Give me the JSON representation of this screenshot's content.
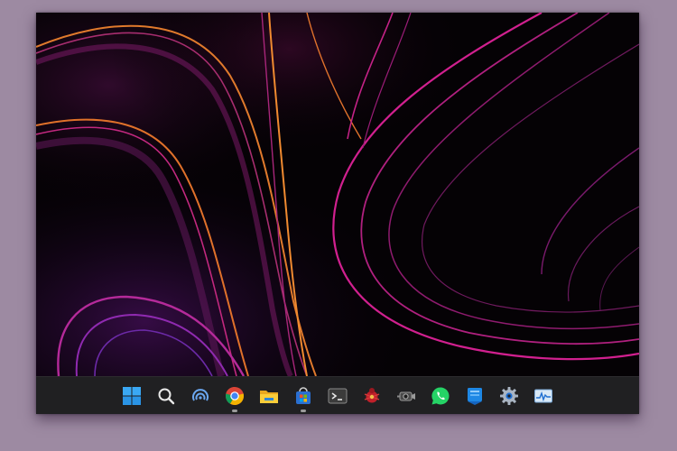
{
  "taskbar": {
    "items": [
      {
        "icon": "windows-start-icon",
        "running": false
      },
      {
        "icon": "search-icon",
        "running": false
      },
      {
        "icon": "copilot-icon",
        "running": false
      },
      {
        "icon": "chrome-icon",
        "running": true
      },
      {
        "icon": "file-explorer-icon",
        "running": false
      },
      {
        "icon": "microsoft-store-icon",
        "running": true
      },
      {
        "icon": "terminal-icon",
        "running": false
      },
      {
        "icon": "red-bug-app-icon",
        "running": false
      },
      {
        "icon": "camera-app-icon",
        "running": false
      },
      {
        "icon": "whatsapp-icon",
        "running": false
      },
      {
        "icon": "blue-app-icon",
        "running": false
      },
      {
        "icon": "settings-icon",
        "running": false
      },
      {
        "icon": "task-manager-icon",
        "running": false
      }
    ]
  },
  "colors": {
    "page_background": "#9d8aa2",
    "taskbar": "#202022",
    "windows_blue": "#35a6f2",
    "wallpaper_magenta": "#c0208e",
    "wallpaper_orange": "#e06a2a",
    "running_indicator": "#9b9b9b"
  }
}
